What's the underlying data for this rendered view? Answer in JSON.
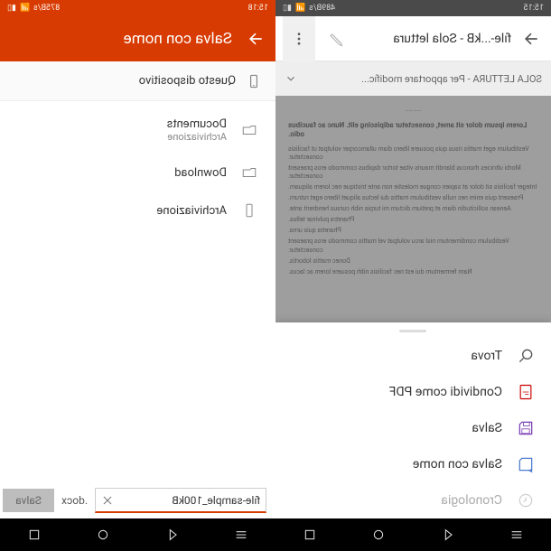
{
  "left": {
    "status": {
      "time": "15:18",
      "net": "875B/s"
    },
    "header": {
      "title": "Salva con nome"
    },
    "device_row": "Questo dispositivo",
    "folders": [
      {
        "name": "Documents",
        "sub": "Archiviazione"
      },
      {
        "name": "Download",
        "sub": ""
      },
      {
        "name": "Archiviazione",
        "sub": ""
      }
    ],
    "bottom": {
      "save": "Salva",
      "ext": ".docx",
      "filename": "file-sample_100kB"
    }
  },
  "right": {
    "status": {
      "time": "15:15",
      "net": "489B/s"
    },
    "header": {
      "title": "file-...kB - Sola lettura"
    },
    "banner": "SOLA LETTURA - Per apportare modific...",
    "doc": {
      "h1": "Lorem ipsum dolor sit amet, consectetur adipiscing elit. Nunc ac faucibus odio."
    },
    "sheet": {
      "find": "Trova",
      "sharepdf": "Condividi come PDF",
      "save": "Salva",
      "saveas": "Salva con nome",
      "history": "Cronologia"
    }
  }
}
